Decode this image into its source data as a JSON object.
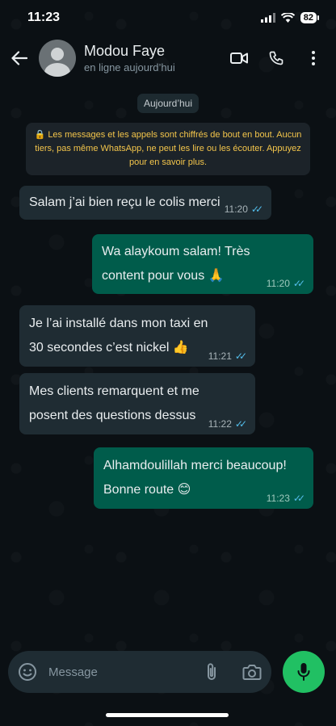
{
  "status_bar": {
    "time": "11:23",
    "battery": "82"
  },
  "header": {
    "contact_name": "Modou Faye",
    "status": "en ligne aujourd’hui"
  },
  "date_label": "Aujourd’hui",
  "encryption_notice": "🔒 Les messages et les appels sont chiffrés de bout en bout. Aucun tiers, pas même WhatsApp, ne peut les lire ou les écouter. Appuyez pour en savoir plus.",
  "messages": [
    {
      "direction": "incoming",
      "text": "Salam j’ai bien reçu le colis merci",
      "time": "11:20"
    },
    {
      "direction": "outgoing",
      "text": "Wa alaykoum salam! Très content pour vous 🙏",
      "time": "11:20"
    },
    {
      "direction": "incoming",
      "text": "Je l’ai installé dans mon taxi en 30 secondes c’est nickel 👍",
      "time": "11:21"
    },
    {
      "direction": "incoming",
      "text": "Mes clients remarquent et me posent des questions dessus",
      "time": "11:22"
    },
    {
      "direction": "outgoing",
      "text": "Alhamdoulillah merci beaucoup! Bonne route 😊",
      "time": "11:23"
    }
  ],
  "composer": {
    "placeholder": "Message"
  },
  "colors": {
    "incoming": "#1f2c33",
    "outgoing": "#005c4b",
    "accent": "#21c063",
    "ticks": "#53bdeb"
  },
  "icons": [
    "back-arrow-icon",
    "video-call-icon",
    "phone-icon",
    "more-vert-icon",
    "emoji-icon",
    "attach-icon",
    "camera-icon",
    "mic-icon"
  ]
}
